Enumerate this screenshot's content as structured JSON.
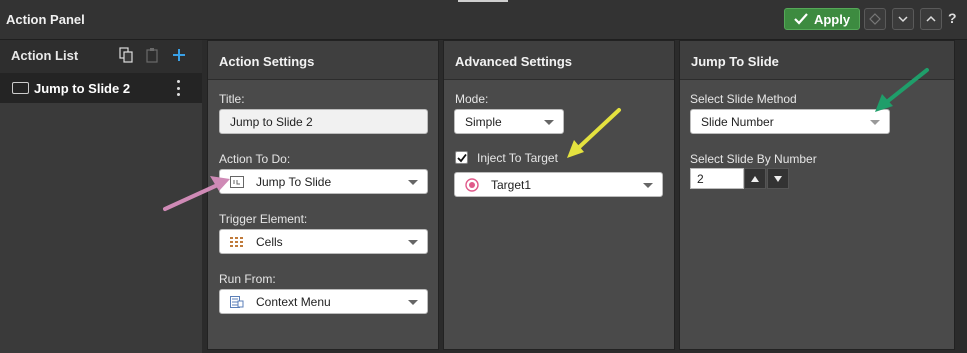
{
  "header": {
    "title": "Action Panel",
    "apply_label": "Apply",
    "help_label": "?"
  },
  "sidebar": {
    "title": "Action List",
    "items": [
      {
        "label": "Jump to Slide 2"
      }
    ]
  },
  "action_settings": {
    "title": "Action Settings",
    "title_label": "Title:",
    "title_value": "Jump to Slide 2",
    "action_label": "Action To Do:",
    "action_value": "Jump To Slide",
    "trigger_label": "Trigger Element:",
    "trigger_value": "Cells",
    "run_label": "Run From:",
    "run_value": "Context Menu"
  },
  "advanced_settings": {
    "title": "Advanced Settings",
    "mode_label": "Mode:",
    "mode_value": "Simple",
    "inject_label": "Inject To Target",
    "inject_checked": true,
    "target_value": "Target1"
  },
  "jump_to_slide": {
    "title": "Jump To Slide",
    "method_label": "Select Slide Method",
    "method_value": "Slide Number",
    "number_label": "Select Slide By Number",
    "number_value": "2"
  },
  "colors": {
    "apply_green": "#3d8b40",
    "arrow_pink": "#cf8ab6",
    "arrow_yellow": "#e4e23f",
    "arrow_green": "#1f9e6a"
  }
}
